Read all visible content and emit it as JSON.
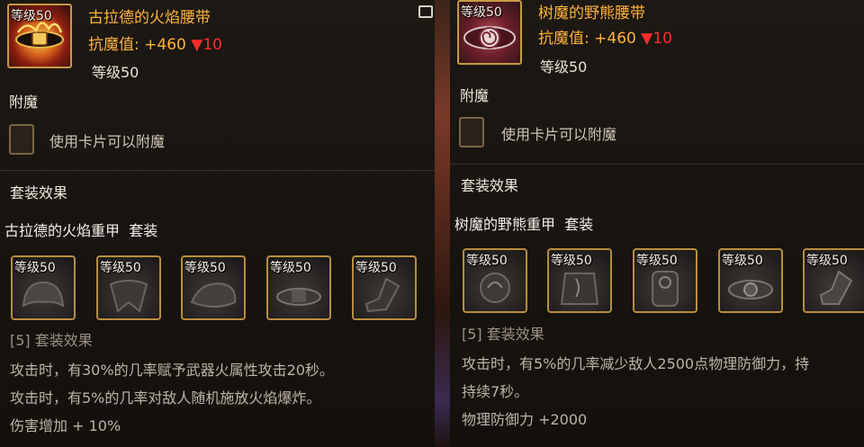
{
  "left": {
    "item": {
      "level_tag": "等级50",
      "name": "古拉德的火焰腰带",
      "stat_label": "抗魔值:",
      "stat_value": "+460",
      "stat_change_symbol": "▼",
      "stat_change": "10",
      "level_req": "等级50"
    },
    "enchant": {
      "title": "附魔",
      "hint": "使用卡片可以附魔"
    },
    "set": {
      "section_title": "套装效果",
      "name": "古拉德的火焰重甲",
      "name_suffix": "套装",
      "pieces": [
        {
          "level": "等级50",
          "icon": "helmet-icon"
        },
        {
          "level": "等级50",
          "icon": "shoulder-armor-icon"
        },
        {
          "level": "等级50",
          "icon": "chest-armor-icon"
        },
        {
          "level": "等级50",
          "icon": "belt-icon"
        },
        {
          "level": "等级50",
          "icon": "boots-icon"
        }
      ],
      "bonus_title": "[5] 套装效果",
      "bonus_lines": [
        "攻击时，有30%的几率赋予武器火属性攻击20秒。",
        "攻击时，有5%的几率对敌人随机施放火焰爆炸。",
        "伤害增加 + 10%"
      ]
    }
  },
  "right": {
    "item": {
      "level_tag": "等级50",
      "name": "树魔的野熊腰带",
      "stat_label": "抗魔值:",
      "stat_value": "+460",
      "stat_change_symbol": "▼",
      "stat_change": "10",
      "level_req": "等级50"
    },
    "enchant": {
      "title": "附魔",
      "hint": "使用卡片可以附魔"
    },
    "set": {
      "section_title": "套装效果",
      "name": "树魔的野熊重甲",
      "name_suffix": "套装",
      "pieces": [
        {
          "level": "等级50",
          "icon": "shoulder-armor-icon"
        },
        {
          "level": "等级50",
          "icon": "chest-armor-icon"
        },
        {
          "level": "等级50",
          "icon": "leg-armor-icon"
        },
        {
          "level": "等级50",
          "icon": "belt-icon"
        },
        {
          "level": "等级50",
          "icon": "boots-icon"
        }
      ],
      "bonus_title": "[5] 套装效果",
      "bonus_lines": [
        "攻击时，有5%的几率减少敌人2500点物理防御力，持",
        "持续7秒。",
        "物理防御力 +2000"
      ]
    }
  },
  "colors": {
    "item_name": "#ffb23a",
    "stat_down": "#ff2d2d",
    "frame_gold": "#c79a47"
  }
}
